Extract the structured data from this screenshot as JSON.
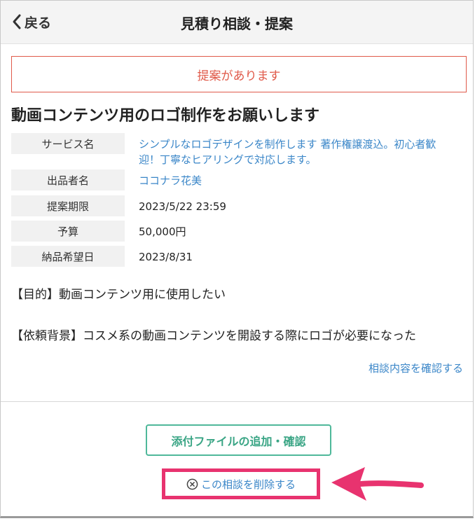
{
  "nav": {
    "back_label": "戻る",
    "title": "見積り相談・提案"
  },
  "banner": {
    "text": "提案があります"
  },
  "request": {
    "title": "動画コンテンツ用のロゴ制作をお願いします",
    "info": [
      {
        "label": "サービス名",
        "value_line1": "シンプルなロゴデザインを制作します 著作権譲渡込。初心者歓",
        "value_line2": "迎！丁寧なヒアリングで対応します。"
      },
      {
        "label": "出品者名",
        "value": "ココナラ花美"
      },
      {
        "label": "提案期限",
        "value": "2023/5/22 23:59"
      },
      {
        "label": "予算",
        "value": "50,000円"
      },
      {
        "label": "納品希望日",
        "value": "2023/8/31"
      }
    ],
    "purpose": "【目的】動画コンテンツ用に使用したい",
    "background": "【依頼背景】コスメ系の動画コンテンツを開設する際にロゴが必要になった",
    "confirm_link": "相談内容を確認する"
  },
  "actions": {
    "attach_label": "添付ファイルの追加・確認",
    "delete_label": "この相談を削除する"
  },
  "colors": {
    "accent_red": "#e05a4a",
    "link_blue": "#3a86c8",
    "button_green": "#3aa585",
    "highlight_pink": "#e8336f"
  }
}
